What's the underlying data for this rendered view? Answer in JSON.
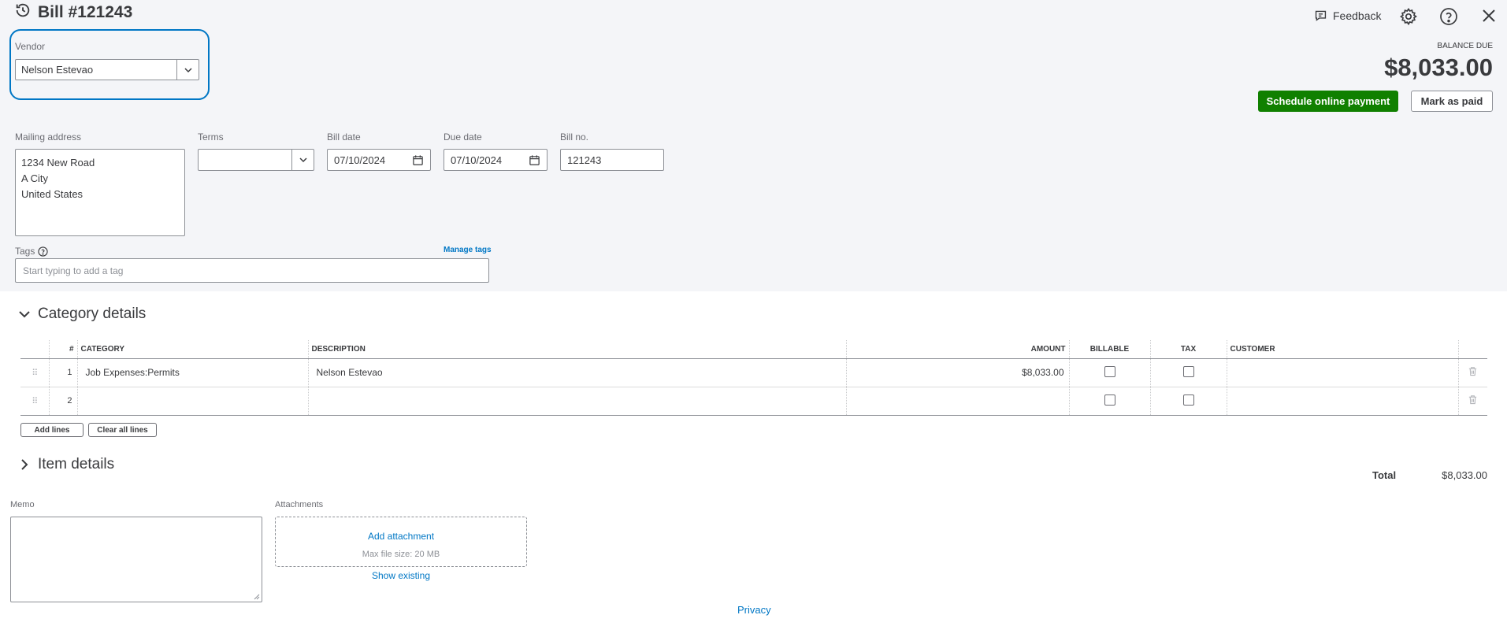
{
  "header": {
    "title": "Bill #121243",
    "feedback_label": "Feedback",
    "balance_due_label": "BALANCE DUE",
    "balance_due_value": "$8,033.00",
    "schedule_payment_label": "Schedule online payment",
    "mark_paid_label": "Mark as paid"
  },
  "vendor": {
    "label": "Vendor",
    "value": "Nelson Estevao"
  },
  "mailing_address": {
    "label": "Mailing address",
    "lines": [
      "1234 New Road",
      "A City",
      "United States"
    ]
  },
  "terms": {
    "label": "Terms",
    "value": ""
  },
  "bill_date": {
    "label": "Bill date",
    "value": "07/10/2024"
  },
  "due_date": {
    "label": "Due date",
    "value": "07/10/2024"
  },
  "bill_no": {
    "label": "Bill no.",
    "value": "121243"
  },
  "tags": {
    "label": "Tags",
    "manage_label": "Manage tags",
    "placeholder": "Start typing to add a tag"
  },
  "category_details": {
    "title": "Category details",
    "columns": [
      "#",
      "CATEGORY",
      "DESCRIPTION",
      "AMOUNT",
      "BILLABLE",
      "TAX",
      "CUSTOMER"
    ],
    "rows": [
      {
        "num": "1",
        "category": "Job Expenses:Permits",
        "description": "Nelson Estevao",
        "amount": "$8,033.00",
        "customer": ""
      },
      {
        "num": "2",
        "category": "",
        "description": "",
        "amount": "",
        "customer": ""
      }
    ],
    "add_lines_label": "Add lines",
    "clear_lines_label": "Clear all lines"
  },
  "item_details": {
    "title": "Item details"
  },
  "total": {
    "label": "Total",
    "value": "$8,033.00"
  },
  "memo": {
    "label": "Memo"
  },
  "attachments": {
    "label": "Attachments",
    "add_label": "Add attachment",
    "max_size": "Max file size: 20 MB",
    "show_existing": "Show existing"
  },
  "footer": {
    "privacy_label": "Privacy"
  },
  "colors": {
    "accent_blue": "#0077c5",
    "primary_green": "#108000",
    "top_bg": "#f4f5f8"
  }
}
